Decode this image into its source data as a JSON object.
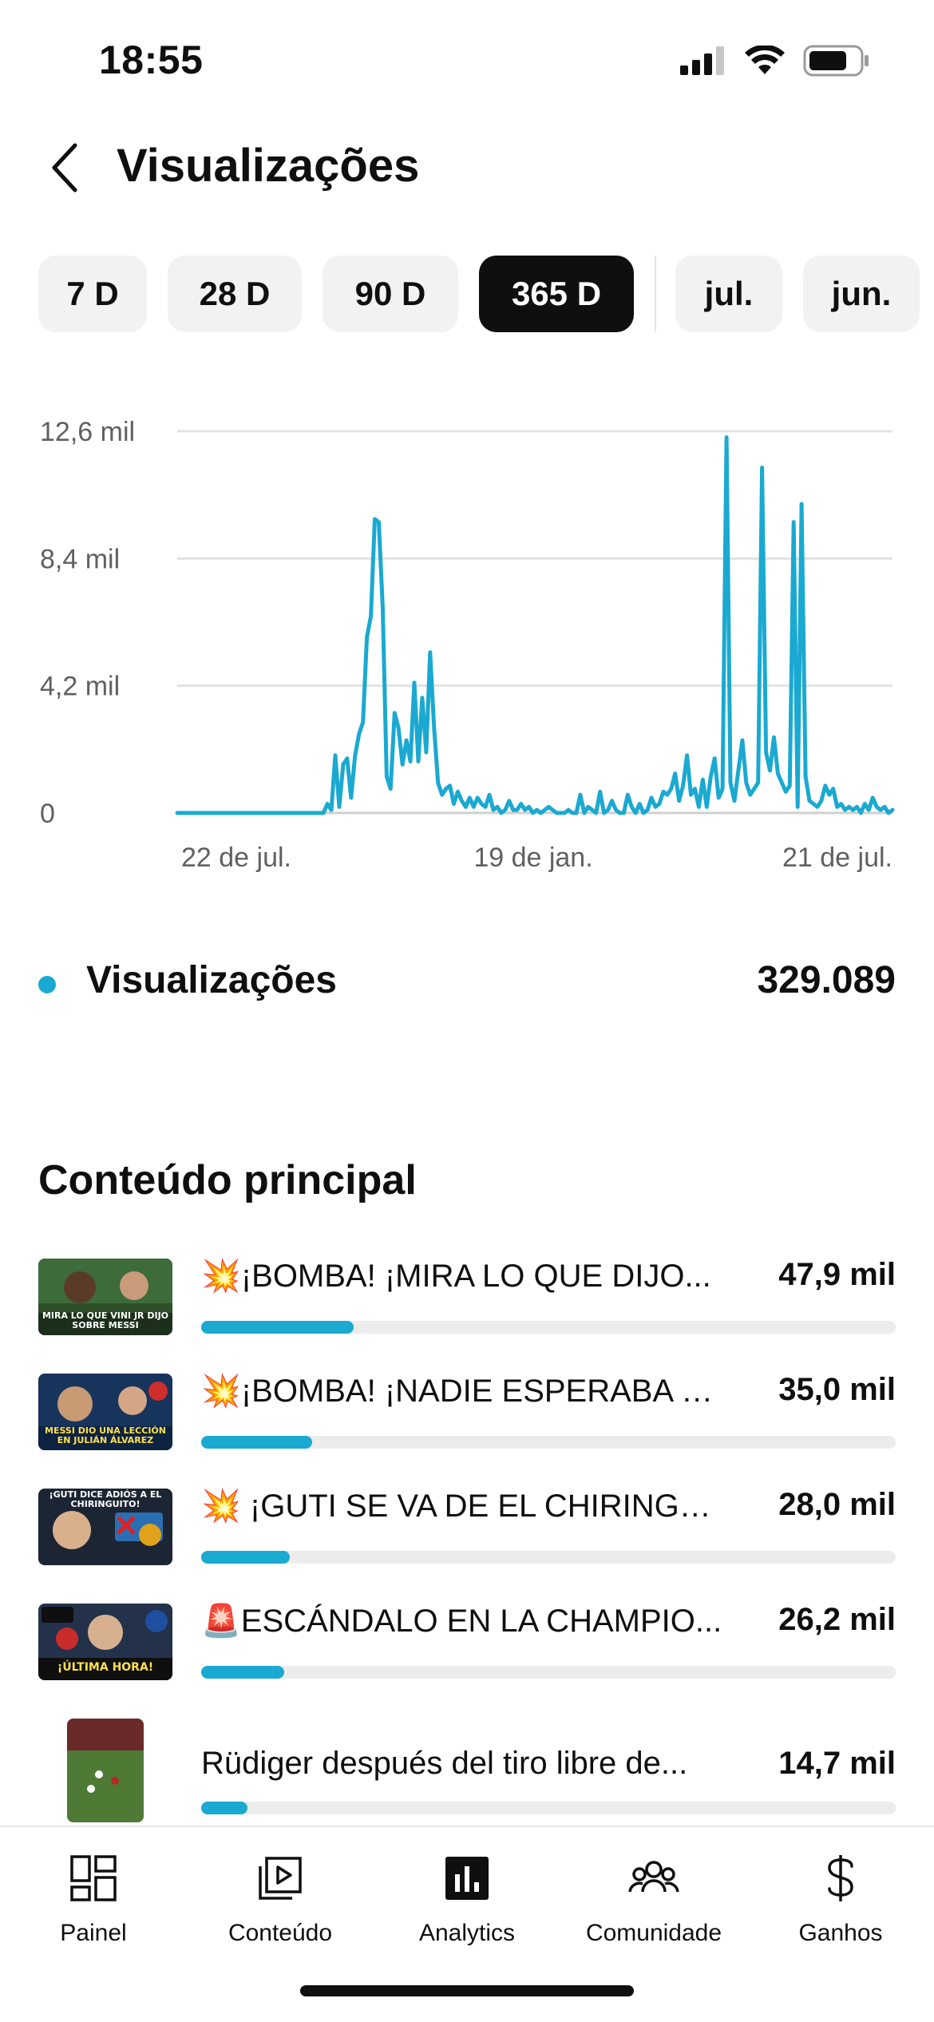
{
  "status_bar": {
    "time": "18:55"
  },
  "header": {
    "title": "Visualizações"
  },
  "chips": [
    {
      "label": "7 D",
      "active": false
    },
    {
      "label": "28 D",
      "active": false
    },
    {
      "label": "90 D",
      "active": false
    },
    {
      "label": "365 D",
      "active": true
    },
    {
      "label": "jul.",
      "active": false
    },
    {
      "label": "jun.",
      "active": false
    }
  ],
  "chart_data": {
    "type": "line",
    "color": "#1aa9d1",
    "y_ticks": [
      "12,6 mil",
      "8,4 mil",
      "4,2 mil",
      "0"
    ],
    "x_ticks": [
      "22 de jul.",
      "19 de jan.",
      "21 de jul."
    ],
    "ylim": [
      0,
      12600
    ],
    "grid": true,
    "series": [
      {
        "values": [
          0,
          0,
          0,
          0,
          0,
          0,
          0,
          0,
          0,
          0,
          0,
          0,
          0,
          0,
          0,
          0,
          0,
          0,
          0,
          0,
          0,
          0,
          0,
          0,
          0,
          0,
          0,
          0,
          0,
          0,
          0,
          0,
          0,
          0,
          0,
          0,
          0,
          0,
          300,
          100,
          1900,
          200,
          1600,
          1800,
          500,
          1900,
          2600,
          3000,
          5800,
          6500,
          9700,
          9600,
          6800,
          1200,
          800,
          3300,
          2800,
          1600,
          2400,
          1700,
          4300,
          1700,
          3800,
          2000,
          5300,
          2800,
          1000,
          600,
          800,
          900,
          300,
          700,
          400,
          200,
          500,
          200,
          500,
          300,
          200,
          600,
          100,
          200,
          0,
          100,
          400,
          100,
          100,
          300,
          100,
          200,
          0,
          100,
          0,
          100,
          200,
          100,
          0,
          0,
          0,
          100,
          0,
          0,
          600,
          0,
          200,
          100,
          0,
          700,
          0,
          100,
          400,
          100,
          0,
          0,
          600,
          200,
          0,
          300,
          0,
          100,
          500,
          200,
          300,
          700,
          600,
          800,
          1300,
          400,
          900,
          1900,
          600,
          800,
          200,
          1100,
          200,
          1200,
          1800,
          500,
          800,
          12400,
          1000,
          400,
          1400,
          2400,
          1000,
          600,
          800,
          1000,
          11400,
          2000,
          1400,
          2500,
          1300,
          1000,
          700,
          900,
          9600,
          200,
          10200,
          1200,
          400,
          300,
          200,
          400,
          900,
          600,
          800,
          200,
          300,
          100,
          200,
          100,
          200,
          0,
          300,
          100,
          500,
          200,
          100,
          200,
          0,
          100
        ]
      }
    ]
  },
  "legend": {
    "label": "Visualizações",
    "value": "329.089"
  },
  "top_content": {
    "title": "Conteúdo principal",
    "items": [
      {
        "emoji": "💥",
        "title": "¡BOMBA! ¡MIRA LO QUE DIJO...",
        "value": "47,9 mil",
        "fraction": 0.219
      },
      {
        "emoji": "💥",
        "title": "¡BOMBA! ¡NADIE ESPERABA E...",
        "value": "35,0 mil",
        "fraction": 0.16
      },
      {
        "emoji": "💥",
        "title": " ¡GUTI SE VA DE EL CHIRINGUI...",
        "value": "28,0 mil",
        "fraction": 0.128
      },
      {
        "emoji": "🚨",
        "title": "ESCÁNDALO EN LA CHAMPIO...",
        "value": "26,2 mil",
        "fraction": 0.12
      },
      {
        "emoji": "",
        "title": "Rüdiger después del tiro libre de...",
        "value": "14,7 mil",
        "fraction": 0.067
      }
    ],
    "thumbnail_texts": [
      "MIRA LO QUE VINI JR DIJO SOBRE MESSI",
      "MESSI DIO UNA LECCIÓN EN JULIÁN ÁLVAREZ",
      "¡GUTI DICE ADIÓS A EL CHIRINGUITO!",
      "¡ÚLTIMA HORA!"
    ]
  },
  "bottom_nav": [
    {
      "label": "Painel",
      "icon": "dashboard-icon"
    },
    {
      "label": "Conteúdo",
      "icon": "content-icon"
    },
    {
      "label": "Analytics",
      "icon": "analytics-icon"
    },
    {
      "label": "Comunidade",
      "icon": "community-icon"
    },
    {
      "label": "Ganhos",
      "icon": "dollar-icon"
    }
  ]
}
